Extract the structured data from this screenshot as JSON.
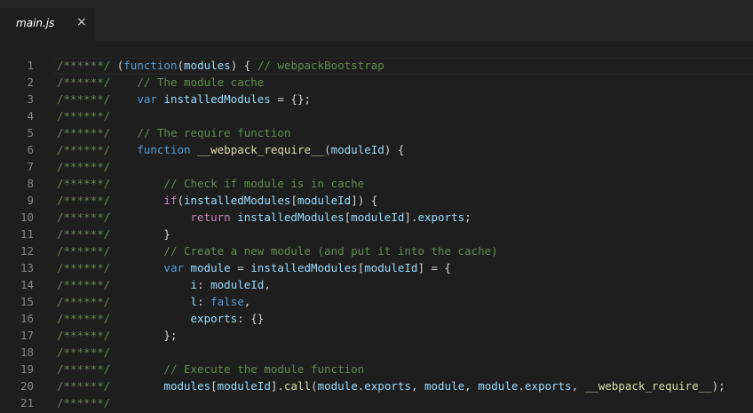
{
  "tab": {
    "title": "main.js",
    "close_glyph": "×"
  },
  "colors": {
    "comment": "#608b4e",
    "keyword": "#569cd6",
    "control": "#c586c0",
    "variable": "#9cdcfe",
    "function": "#dcdcaa",
    "plain": "#d4d4d4",
    "line_number": "#858585",
    "background": "#1e1e1e"
  },
  "lines": [
    {
      "num": "1",
      "tokens": [
        [
          "cm",
          "/******/ "
        ],
        [
          "pl",
          "("
        ],
        [
          "kw",
          "function"
        ],
        [
          "pl",
          "("
        ],
        [
          "vr",
          "modules"
        ],
        [
          "pl",
          ") { "
        ],
        [
          "cm",
          "// webpackBootstrap"
        ]
      ]
    },
    {
      "num": "2",
      "tokens": [
        [
          "cm",
          "/******/ "
        ],
        [
          "pl",
          "   "
        ],
        [
          "cm",
          "// The module cache"
        ]
      ]
    },
    {
      "num": "3",
      "tokens": [
        [
          "cm",
          "/******/ "
        ],
        [
          "pl",
          "   "
        ],
        [
          "kw",
          "var"
        ],
        [
          "pl",
          " "
        ],
        [
          "vr",
          "installedModules"
        ],
        [
          "pl",
          " = {};"
        ]
      ]
    },
    {
      "num": "4",
      "tokens": [
        [
          "cm",
          "/******/"
        ]
      ]
    },
    {
      "num": "5",
      "tokens": [
        [
          "cm",
          "/******/ "
        ],
        [
          "pl",
          "   "
        ],
        [
          "cm",
          "// The require function"
        ]
      ]
    },
    {
      "num": "6",
      "tokens": [
        [
          "cm",
          "/******/ "
        ],
        [
          "pl",
          "   "
        ],
        [
          "kw",
          "function"
        ],
        [
          "pl",
          " "
        ],
        [
          "fn",
          "__webpack_require__"
        ],
        [
          "pl",
          "("
        ],
        [
          "vr",
          "moduleId"
        ],
        [
          "pl",
          ") {"
        ]
      ]
    },
    {
      "num": "7",
      "tokens": [
        [
          "cm",
          "/******/"
        ]
      ]
    },
    {
      "num": "8",
      "tokens": [
        [
          "cm",
          "/******/ "
        ],
        [
          "pl",
          "       "
        ],
        [
          "cm",
          "// Check if module is in cache"
        ]
      ]
    },
    {
      "num": "9",
      "tokens": [
        [
          "cm",
          "/******/ "
        ],
        [
          "pl",
          "       "
        ],
        [
          "ctl",
          "if"
        ],
        [
          "pl",
          "("
        ],
        [
          "vr",
          "installedModules"
        ],
        [
          "pl",
          "["
        ],
        [
          "vr",
          "moduleId"
        ],
        [
          "pl",
          "]) {"
        ]
      ]
    },
    {
      "num": "10",
      "tokens": [
        [
          "cm",
          "/******/ "
        ],
        [
          "pl",
          "           "
        ],
        [
          "ctl",
          "return"
        ],
        [
          "pl",
          " "
        ],
        [
          "vr",
          "installedModules"
        ],
        [
          "pl",
          "["
        ],
        [
          "vr",
          "moduleId"
        ],
        [
          "pl",
          "]."
        ],
        [
          "vr",
          "exports"
        ],
        [
          "pl",
          ";"
        ]
      ]
    },
    {
      "num": "11",
      "tokens": [
        [
          "cm",
          "/******/ "
        ],
        [
          "pl",
          "       }"
        ]
      ]
    },
    {
      "num": "12",
      "tokens": [
        [
          "cm",
          "/******/ "
        ],
        [
          "pl",
          "       "
        ],
        [
          "cm",
          "// Create a new module (and put it into the cache)"
        ]
      ]
    },
    {
      "num": "13",
      "tokens": [
        [
          "cm",
          "/******/ "
        ],
        [
          "pl",
          "       "
        ],
        [
          "kw",
          "var"
        ],
        [
          "pl",
          " "
        ],
        [
          "vr",
          "module"
        ],
        [
          "pl",
          " = "
        ],
        [
          "vr",
          "installedModules"
        ],
        [
          "pl",
          "["
        ],
        [
          "vr",
          "moduleId"
        ],
        [
          "pl",
          "] = {"
        ]
      ]
    },
    {
      "num": "14",
      "tokens": [
        [
          "cm",
          "/******/ "
        ],
        [
          "pl",
          "           "
        ],
        [
          "vr",
          "i"
        ],
        [
          "pl",
          ": "
        ],
        [
          "vr",
          "moduleId"
        ],
        [
          "pl",
          ","
        ]
      ]
    },
    {
      "num": "15",
      "tokens": [
        [
          "cm",
          "/******/ "
        ],
        [
          "pl",
          "           "
        ],
        [
          "vr",
          "l"
        ],
        [
          "pl",
          ": "
        ],
        [
          "kw",
          "false"
        ],
        [
          "pl",
          ","
        ]
      ]
    },
    {
      "num": "16",
      "tokens": [
        [
          "cm",
          "/******/ "
        ],
        [
          "pl",
          "           "
        ],
        [
          "vr",
          "exports"
        ],
        [
          "pl",
          ": {}"
        ]
      ]
    },
    {
      "num": "17",
      "tokens": [
        [
          "cm",
          "/******/ "
        ],
        [
          "pl",
          "       };"
        ]
      ]
    },
    {
      "num": "18",
      "tokens": [
        [
          "cm",
          "/******/"
        ]
      ]
    },
    {
      "num": "19",
      "tokens": [
        [
          "cm",
          "/******/ "
        ],
        [
          "pl",
          "       "
        ],
        [
          "cm",
          "// Execute the module function"
        ]
      ]
    },
    {
      "num": "20",
      "tokens": [
        [
          "cm",
          "/******/ "
        ],
        [
          "pl",
          "       "
        ],
        [
          "vr",
          "modules"
        ],
        [
          "pl",
          "["
        ],
        [
          "vr",
          "moduleId"
        ],
        [
          "pl",
          "]."
        ],
        [
          "fn",
          "call"
        ],
        [
          "pl",
          "("
        ],
        [
          "vr",
          "module"
        ],
        [
          "pl",
          "."
        ],
        [
          "vr",
          "exports"
        ],
        [
          "pl",
          ", "
        ],
        [
          "vr",
          "module"
        ],
        [
          "pl",
          ", "
        ],
        [
          "vr",
          "module"
        ],
        [
          "pl",
          "."
        ],
        [
          "vr",
          "exports"
        ],
        [
          "pl",
          ", "
        ],
        [
          "fn",
          "__webpack_require__"
        ],
        [
          "pl",
          ");"
        ]
      ]
    },
    {
      "num": "21",
      "tokens": [
        [
          "cm",
          "/******/"
        ]
      ]
    }
  ]
}
